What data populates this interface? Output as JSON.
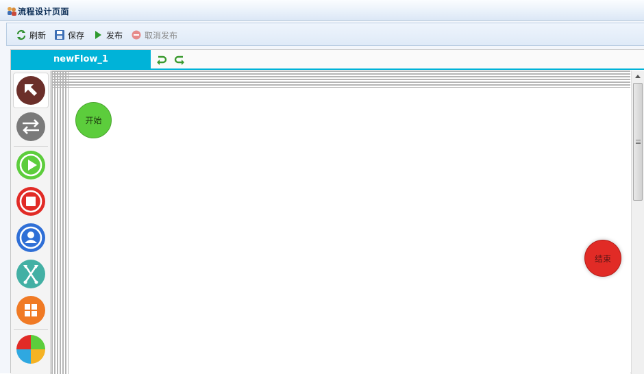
{
  "window": {
    "title": "流程设计页面"
  },
  "toolbar": {
    "refresh_label": "刷新",
    "save_label": "保存",
    "publish_label": "发布",
    "unpublish_label": "取消发布"
  },
  "tabs": [
    {
      "label": "newFlow_1",
      "active": true
    }
  ],
  "palette": {
    "items": [
      "select-pointer-icon",
      "transition-icon",
      "start-node-icon",
      "end-node-icon",
      "user-task-icon",
      "fork-join-icon",
      "subprocess-icon",
      "decision-icon"
    ]
  },
  "canvas": {
    "start_node_label": "开始",
    "end_node_label": "结束"
  },
  "colors": {
    "accent": "#00b3d8",
    "start": "#5ccd3c",
    "end": "#e12b26",
    "user_task": "#2f6fd6",
    "fork": "#43b0a4",
    "subprocess": "#f07a24",
    "select": "#6b2f2a"
  }
}
